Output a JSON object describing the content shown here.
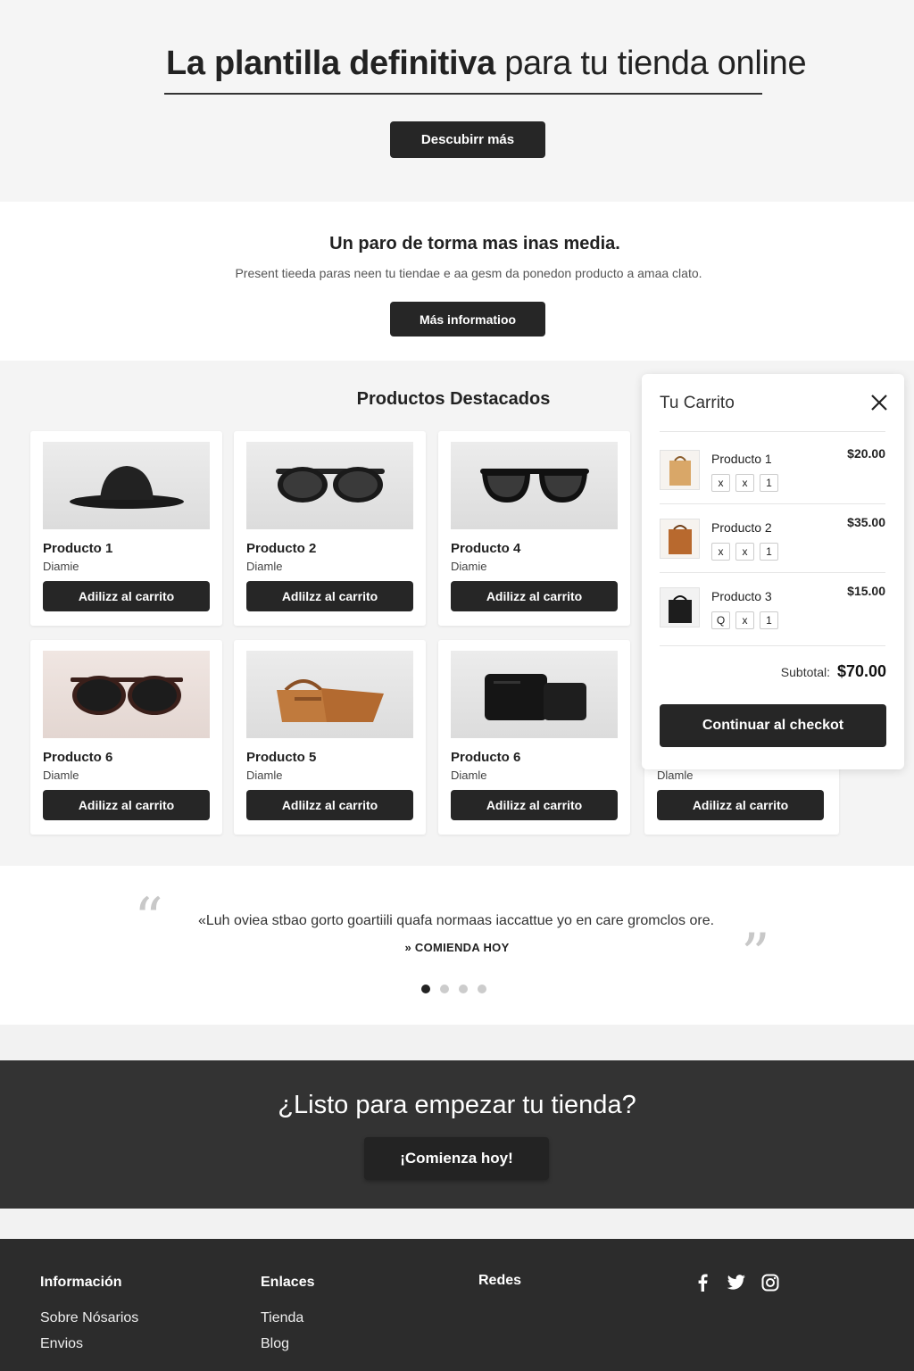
{
  "hero": {
    "title_bold": "La plantilla definitiva",
    "title_light": "para tu tienda online",
    "button": "Descubirr más"
  },
  "info": {
    "title": "Un paro de torma mas inas media.",
    "text": "Present tieeda paras neen tu tiendae e aa gesm da ponedon producto a amaa clato.",
    "button": "Más informatioo"
  },
  "products": {
    "title": "Productos Destacados",
    "items": [
      {
        "name": "Producto 1",
        "sub": "Diamie",
        "button": "Adilizz al carrito",
        "icon": "hat"
      },
      {
        "name": "Producto 2",
        "sub": "Diamle",
        "button": "Adlilzz al carrito",
        "icon": "sunglasses"
      },
      {
        "name": "Producto 4",
        "sub": "Diamie",
        "button": "Adilizz al carrito",
        "icon": "sunglasses"
      },
      {
        "name": "Producto 6",
        "sub": "Diamle",
        "button": "Adilizz al carrito",
        "icon": "sunglasses-brown"
      },
      {
        "name": "Producto 5",
        "sub": "Diamle",
        "button": "Adlilzz al carrito",
        "icon": "handbag"
      },
      {
        "name": "Producto 6",
        "sub": "Diamle",
        "button": "Adilizz al carrito",
        "icon": "wallet"
      },
      {
        "name": "",
        "sub": "Dlamle",
        "button": "Adilizz al carrito",
        "icon": ""
      }
    ]
  },
  "cart": {
    "title": "Tu Carrito",
    "items": [
      {
        "name": "Producto 1",
        "price": "$20.00",
        "q1": "x",
        "q2": "x",
        "q3": "1"
      },
      {
        "name": "Producto 2",
        "price": "$35.00",
        "q1": "x",
        "q2": "x",
        "q3": "1"
      },
      {
        "name": "Producto 3",
        "price": "$15.00",
        "q1": "Q",
        "q2": "x",
        "q3": "1"
      }
    ],
    "subtotal_label": "Subtotal:",
    "subtotal_value": "$70.00",
    "checkout": "Continuar al checkot"
  },
  "testimonial": {
    "text": "«Luh oviea stbao gorto goartiili quafa normaas iaccattue yo en care gromclos ore.",
    "author": "» COMIENDA HOY",
    "dots_active_index": 0
  },
  "cta": {
    "title": "¿Listo para empezar tu tienda?",
    "button": "¡Comienza hoy!"
  },
  "footer": {
    "col1_title": "Información",
    "col1_links": [
      "Sobre Nósarios",
      "Envios"
    ],
    "col2_title": "Enlaces",
    "col2_links": [
      "Tienda",
      "Blog"
    ],
    "col3_title": "Redes"
  },
  "colors": {
    "button_dark": "#262626",
    "cta_bg": "#333333",
    "footer_bg": "#2c2c2c"
  }
}
